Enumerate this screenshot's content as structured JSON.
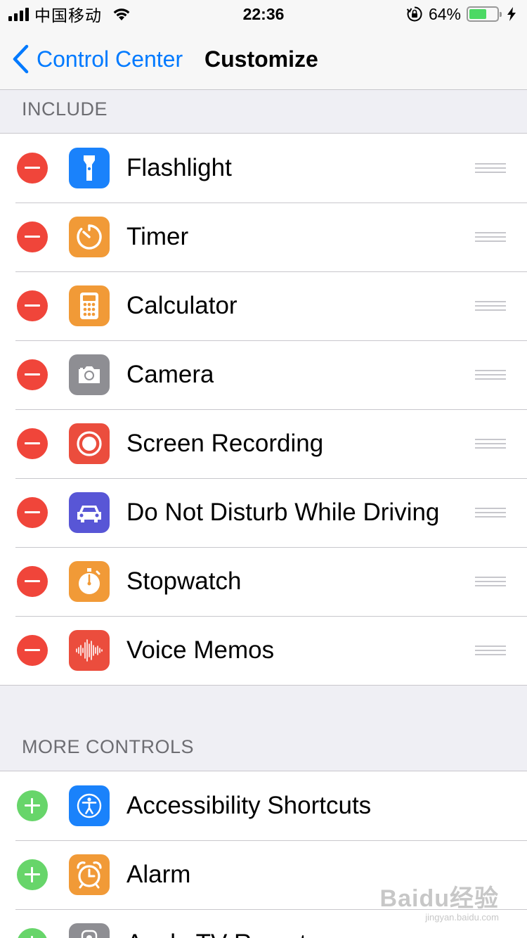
{
  "status_bar": {
    "carrier": "中国移动",
    "time": "22:36",
    "battery_percent": "64%",
    "battery_level": 0.64,
    "icons": [
      "signal-icon",
      "wifi-icon",
      "orientation-lock-icon",
      "battery-icon",
      "charging-icon"
    ]
  },
  "nav": {
    "back_label": "Control Center",
    "title": "Customize"
  },
  "include_section": {
    "header": "INCLUDE",
    "items": [
      {
        "label": "Flashlight",
        "icon": "flashlight-icon",
        "color": "#1a82fb"
      },
      {
        "label": "Timer",
        "icon": "timer-icon",
        "color": "#f19a37"
      },
      {
        "label": "Calculator",
        "icon": "calculator-icon",
        "color": "#f19a37"
      },
      {
        "label": "Camera",
        "icon": "camera-icon",
        "color": "#8e8e93"
      },
      {
        "label": "Screen Recording",
        "icon": "screen-recording-icon",
        "color": "#eb4d3d"
      },
      {
        "label": "Do Not Disturb While Driving",
        "icon": "car-icon",
        "color": "#5856d6"
      },
      {
        "label": "Stopwatch",
        "icon": "stopwatch-icon",
        "color": "#f19a37"
      },
      {
        "label": "Voice Memos",
        "icon": "voice-memos-icon",
        "color": "#eb4d3d"
      }
    ]
  },
  "more_section": {
    "header": "MORE CONTROLS",
    "items": [
      {
        "label": "Accessibility Shortcuts",
        "icon": "accessibility-icon",
        "color": "#1a82fb"
      },
      {
        "label": "Alarm",
        "icon": "alarm-icon",
        "color": "#f19a37"
      },
      {
        "label": "Apple TV Remote",
        "icon": "remote-icon",
        "color": "#8e8e93"
      }
    ]
  },
  "watermark": {
    "text": "Baidu经验",
    "url_text": "jingyan.baidu.com"
  },
  "colors": {
    "accent": "#007aff",
    "remove": "#f0453a",
    "add": "#67d56a"
  }
}
